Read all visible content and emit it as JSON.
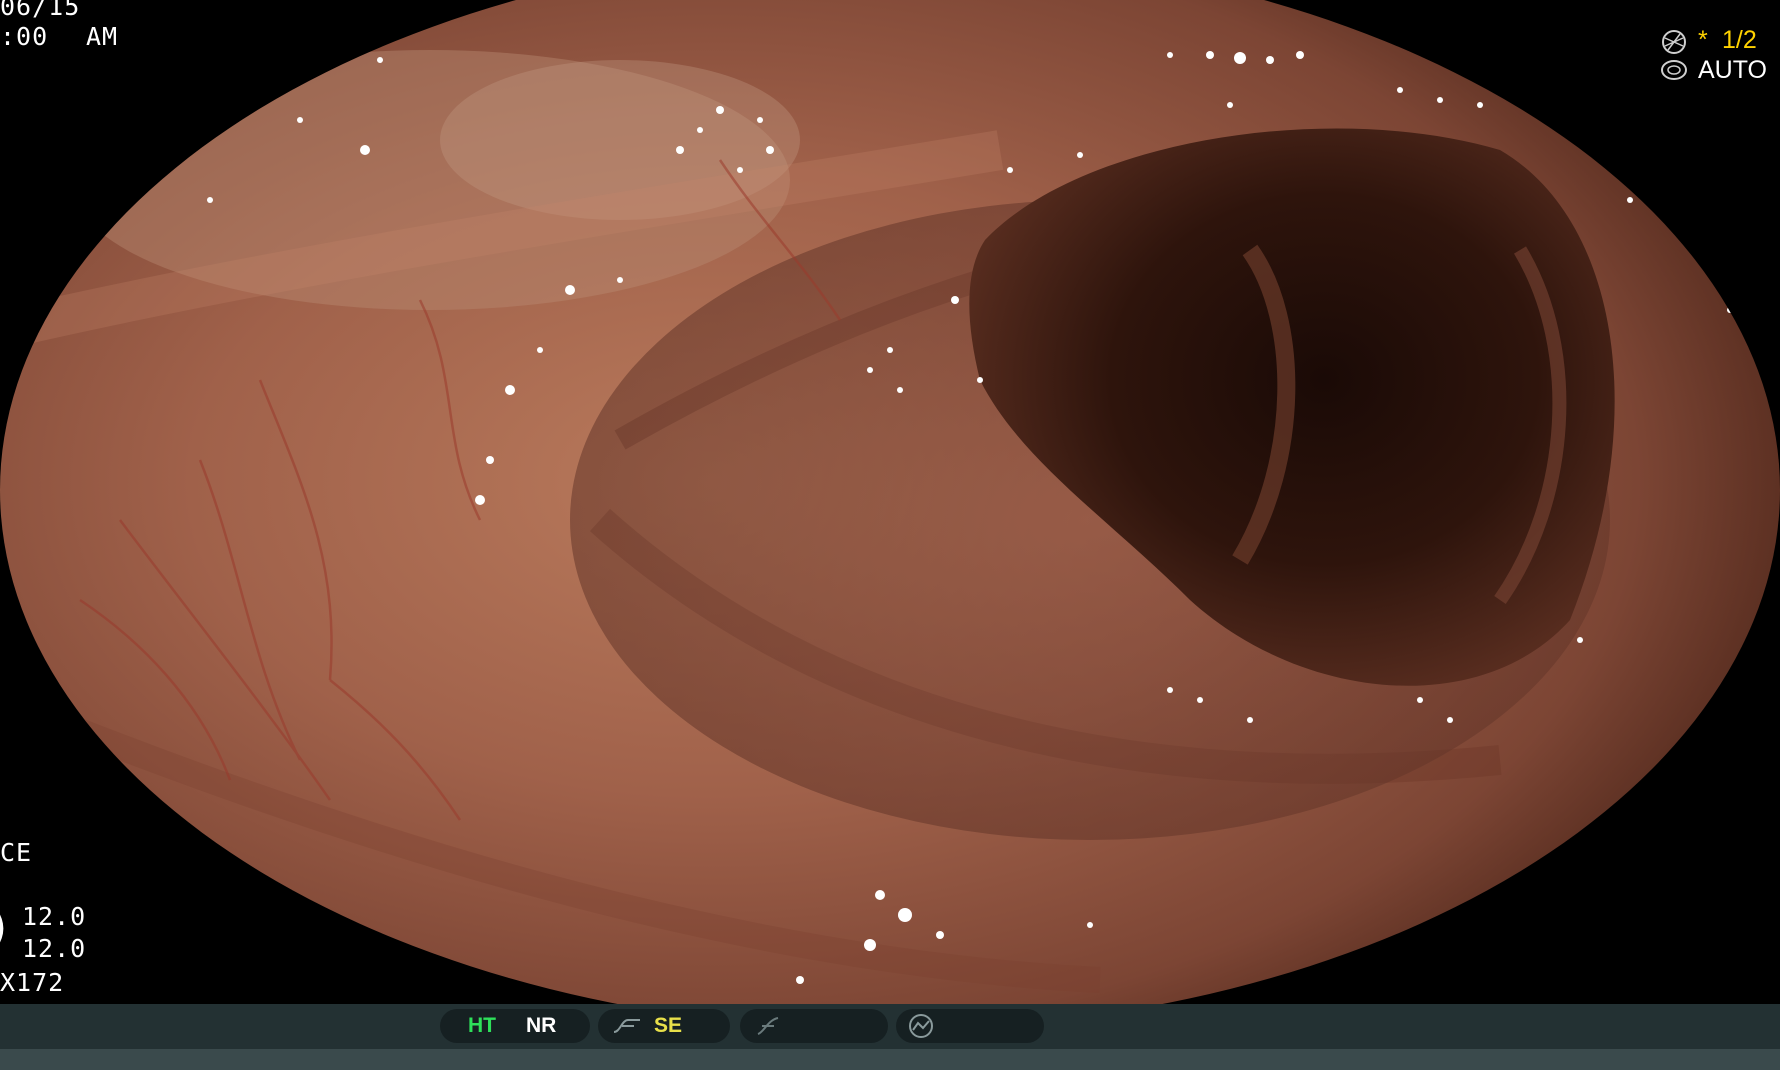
{
  "osd": {
    "date_fragment": "06/15",
    "time_fragment": ":00",
    "ampm": "AM",
    "mode_fragment": "CE",
    "value_1": "12.0",
    "value_2": "12.0",
    "scope_fragment": "X172",
    "ratio_fragment": "1/2",
    "ratio_star": "*",
    "auto_label": "AUTO"
  },
  "status_bar": {
    "ht_label": "HT",
    "nr_label": "NR",
    "se_label": "SE"
  },
  "colors": {
    "ht": "#2ee05a",
    "nr": "#ffffff",
    "se": "#e8e04a",
    "ratio": "#ffd200"
  },
  "icons": {
    "ratio_icon": "shutter-icon",
    "auto_icon": "iris-icon",
    "se_icon": "enhance-curve-icon",
    "blank_icon": "slash-curve-icon",
    "last_icon": "light-gauge-icon",
    "left_icon": "bracket-icon"
  }
}
